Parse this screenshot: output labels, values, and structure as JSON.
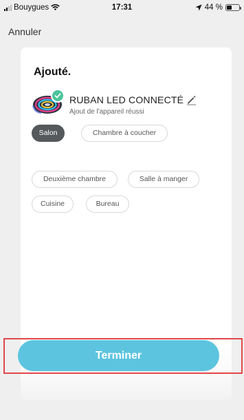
{
  "status_bar": {
    "carrier": "Bouygues",
    "time": "17:31",
    "battery_text": "44 %",
    "battery_level": 0.44
  },
  "header": {
    "cancel_label": "Annuler"
  },
  "card": {
    "title": "Ajouté.",
    "device": {
      "name": "RUBAN LED CONNECTÉ",
      "status": "Ajout de l'appareil réussi",
      "icon": "led-strip-icon",
      "badge_icon": "checkmark-icon"
    },
    "rooms": [
      {
        "label": "Salon",
        "selected": true
      },
      {
        "label": "Chambre à coucher",
        "selected": false
      },
      {
        "label": "Deuxième chambre",
        "selected": false
      },
      {
        "label": "Salle à manger",
        "selected": false
      },
      {
        "label": "Cuisine",
        "selected": false
      },
      {
        "label": "Bureau",
        "selected": false
      }
    ]
  },
  "footer": {
    "finish_label": "Terminer"
  },
  "colors": {
    "accent": "#5dc4df",
    "success": "#4cc49a",
    "selected_chip": "#55595c",
    "highlight": "#e2474b"
  }
}
